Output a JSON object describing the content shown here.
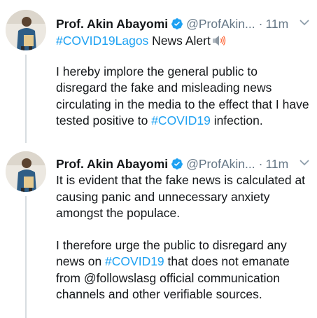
{
  "tweets": [
    {
      "name": "Prof. Akin Abayomi",
      "handle": "@ProfAkin...",
      "separator": "·",
      "time": "11m",
      "hashtag_line": {
        "hashtag": "#COVID19Lagos",
        "text": " News Alert"
      },
      "paragraph": {
        "before": "I hereby implore the general public to disregard the fake and misleading news circulating in the media to the effect that I have tested positive to ",
        "hashtag": "#COVID19",
        "after": " infection."
      }
    },
    {
      "name": "Prof. Akin Abayomi",
      "handle": "@ProfAkin...",
      "separator": "·",
      "time": "11m",
      "paragraph1": "It is evident that the fake news is calculated at causing panic and unnecessary anxiety amongst the populace.",
      "paragraph2": {
        "before": "I therefore urge the public to disregard any news on ",
        "hashtag": "#COVID19",
        "after": " that does not emanate from @followslasg official communication channels and other verifiable sources."
      }
    }
  ],
  "colors": {
    "link": "#1da1f2",
    "muted": "#657786",
    "text": "#14171a",
    "verified": "#1da1f2"
  },
  "icons": {
    "verified": "verified-badge-icon",
    "chevron": "chevron-down-icon",
    "speaker": "loudspeaker-emoji-icon"
  }
}
